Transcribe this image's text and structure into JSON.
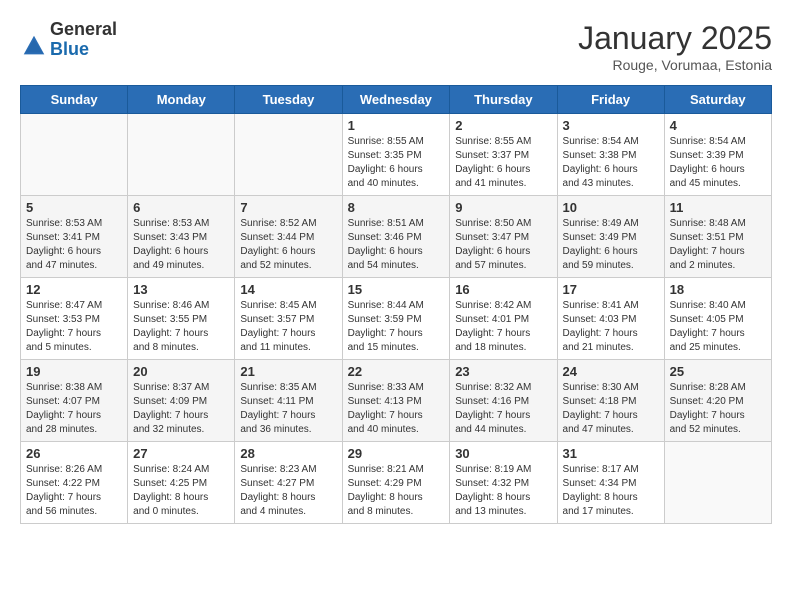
{
  "header": {
    "logo": {
      "general": "General",
      "blue": "Blue"
    },
    "title": "January 2025",
    "subtitle": "Rouge, Vorumaa, Estonia"
  },
  "days_of_week": [
    "Sunday",
    "Monday",
    "Tuesday",
    "Wednesday",
    "Thursday",
    "Friday",
    "Saturday"
  ],
  "weeks": [
    {
      "row_class": "row-odd",
      "days": [
        {
          "num": "",
          "empty": true,
          "sunrise": "",
          "sunset": "",
          "daylight": ""
        },
        {
          "num": "",
          "empty": true,
          "sunrise": "",
          "sunset": "",
          "daylight": ""
        },
        {
          "num": "",
          "empty": true,
          "sunrise": "",
          "sunset": "",
          "daylight": ""
        },
        {
          "num": "1",
          "empty": false,
          "sunrise": "Sunrise: 8:55 AM",
          "sunset": "Sunset: 3:35 PM",
          "daylight": "Daylight: 6 hours and 40 minutes."
        },
        {
          "num": "2",
          "empty": false,
          "sunrise": "Sunrise: 8:55 AM",
          "sunset": "Sunset: 3:37 PM",
          "daylight": "Daylight: 6 hours and 41 minutes."
        },
        {
          "num": "3",
          "empty": false,
          "sunrise": "Sunrise: 8:54 AM",
          "sunset": "Sunset: 3:38 PM",
          "daylight": "Daylight: 6 hours and 43 minutes."
        },
        {
          "num": "4",
          "empty": false,
          "sunrise": "Sunrise: 8:54 AM",
          "sunset": "Sunset: 3:39 PM",
          "daylight": "Daylight: 6 hours and 45 minutes."
        }
      ]
    },
    {
      "row_class": "row-even",
      "days": [
        {
          "num": "5",
          "empty": false,
          "sunrise": "Sunrise: 8:53 AM",
          "sunset": "Sunset: 3:41 PM",
          "daylight": "Daylight: 6 hours and 47 minutes."
        },
        {
          "num": "6",
          "empty": false,
          "sunrise": "Sunrise: 8:53 AM",
          "sunset": "Sunset: 3:43 PM",
          "daylight": "Daylight: 6 hours and 49 minutes."
        },
        {
          "num": "7",
          "empty": false,
          "sunrise": "Sunrise: 8:52 AM",
          "sunset": "Sunset: 3:44 PM",
          "daylight": "Daylight: 6 hours and 52 minutes."
        },
        {
          "num": "8",
          "empty": false,
          "sunrise": "Sunrise: 8:51 AM",
          "sunset": "Sunset: 3:46 PM",
          "daylight": "Daylight: 6 hours and 54 minutes."
        },
        {
          "num": "9",
          "empty": false,
          "sunrise": "Sunrise: 8:50 AM",
          "sunset": "Sunset: 3:47 PM",
          "daylight": "Daylight: 6 hours and 57 minutes."
        },
        {
          "num": "10",
          "empty": false,
          "sunrise": "Sunrise: 8:49 AM",
          "sunset": "Sunset: 3:49 PM",
          "daylight": "Daylight: 6 hours and 59 minutes."
        },
        {
          "num": "11",
          "empty": false,
          "sunrise": "Sunrise: 8:48 AM",
          "sunset": "Sunset: 3:51 PM",
          "daylight": "Daylight: 7 hours and 2 minutes."
        }
      ]
    },
    {
      "row_class": "row-odd",
      "days": [
        {
          "num": "12",
          "empty": false,
          "sunrise": "Sunrise: 8:47 AM",
          "sunset": "Sunset: 3:53 PM",
          "daylight": "Daylight: 7 hours and 5 minutes."
        },
        {
          "num": "13",
          "empty": false,
          "sunrise": "Sunrise: 8:46 AM",
          "sunset": "Sunset: 3:55 PM",
          "daylight": "Daylight: 7 hours and 8 minutes."
        },
        {
          "num": "14",
          "empty": false,
          "sunrise": "Sunrise: 8:45 AM",
          "sunset": "Sunset: 3:57 PM",
          "daylight": "Daylight: 7 hours and 11 minutes."
        },
        {
          "num": "15",
          "empty": false,
          "sunrise": "Sunrise: 8:44 AM",
          "sunset": "Sunset: 3:59 PM",
          "daylight": "Daylight: 7 hours and 15 minutes."
        },
        {
          "num": "16",
          "empty": false,
          "sunrise": "Sunrise: 8:42 AM",
          "sunset": "Sunset: 4:01 PM",
          "daylight": "Daylight: 7 hours and 18 minutes."
        },
        {
          "num": "17",
          "empty": false,
          "sunrise": "Sunrise: 8:41 AM",
          "sunset": "Sunset: 4:03 PM",
          "daylight": "Daylight: 7 hours and 21 minutes."
        },
        {
          "num": "18",
          "empty": false,
          "sunrise": "Sunrise: 8:40 AM",
          "sunset": "Sunset: 4:05 PM",
          "daylight": "Daylight: 7 hours and 25 minutes."
        }
      ]
    },
    {
      "row_class": "row-even",
      "days": [
        {
          "num": "19",
          "empty": false,
          "sunrise": "Sunrise: 8:38 AM",
          "sunset": "Sunset: 4:07 PM",
          "daylight": "Daylight: 7 hours and 28 minutes."
        },
        {
          "num": "20",
          "empty": false,
          "sunrise": "Sunrise: 8:37 AM",
          "sunset": "Sunset: 4:09 PM",
          "daylight": "Daylight: 7 hours and 32 minutes."
        },
        {
          "num": "21",
          "empty": false,
          "sunrise": "Sunrise: 8:35 AM",
          "sunset": "Sunset: 4:11 PM",
          "daylight": "Daylight: 7 hours and 36 minutes."
        },
        {
          "num": "22",
          "empty": false,
          "sunrise": "Sunrise: 8:33 AM",
          "sunset": "Sunset: 4:13 PM",
          "daylight": "Daylight: 7 hours and 40 minutes."
        },
        {
          "num": "23",
          "empty": false,
          "sunrise": "Sunrise: 8:32 AM",
          "sunset": "Sunset: 4:16 PM",
          "daylight": "Daylight: 7 hours and 44 minutes."
        },
        {
          "num": "24",
          "empty": false,
          "sunrise": "Sunrise: 8:30 AM",
          "sunset": "Sunset: 4:18 PM",
          "daylight": "Daylight: 7 hours and 47 minutes."
        },
        {
          "num": "25",
          "empty": false,
          "sunrise": "Sunrise: 8:28 AM",
          "sunset": "Sunset: 4:20 PM",
          "daylight": "Daylight: 7 hours and 52 minutes."
        }
      ]
    },
    {
      "row_class": "row-odd",
      "days": [
        {
          "num": "26",
          "empty": false,
          "sunrise": "Sunrise: 8:26 AM",
          "sunset": "Sunset: 4:22 PM",
          "daylight": "Daylight: 7 hours and 56 minutes."
        },
        {
          "num": "27",
          "empty": false,
          "sunrise": "Sunrise: 8:24 AM",
          "sunset": "Sunset: 4:25 PM",
          "daylight": "Daylight: 8 hours and 0 minutes."
        },
        {
          "num": "28",
          "empty": false,
          "sunrise": "Sunrise: 8:23 AM",
          "sunset": "Sunset: 4:27 PM",
          "daylight": "Daylight: 8 hours and 4 minutes."
        },
        {
          "num": "29",
          "empty": false,
          "sunrise": "Sunrise: 8:21 AM",
          "sunset": "Sunset: 4:29 PM",
          "daylight": "Daylight: 8 hours and 8 minutes."
        },
        {
          "num": "30",
          "empty": false,
          "sunrise": "Sunrise: 8:19 AM",
          "sunset": "Sunset: 4:32 PM",
          "daylight": "Daylight: 8 hours and 13 minutes."
        },
        {
          "num": "31",
          "empty": false,
          "sunrise": "Sunrise: 8:17 AM",
          "sunset": "Sunset: 4:34 PM",
          "daylight": "Daylight: 8 hours and 17 minutes."
        },
        {
          "num": "",
          "empty": true,
          "sunrise": "",
          "sunset": "",
          "daylight": ""
        }
      ]
    }
  ]
}
